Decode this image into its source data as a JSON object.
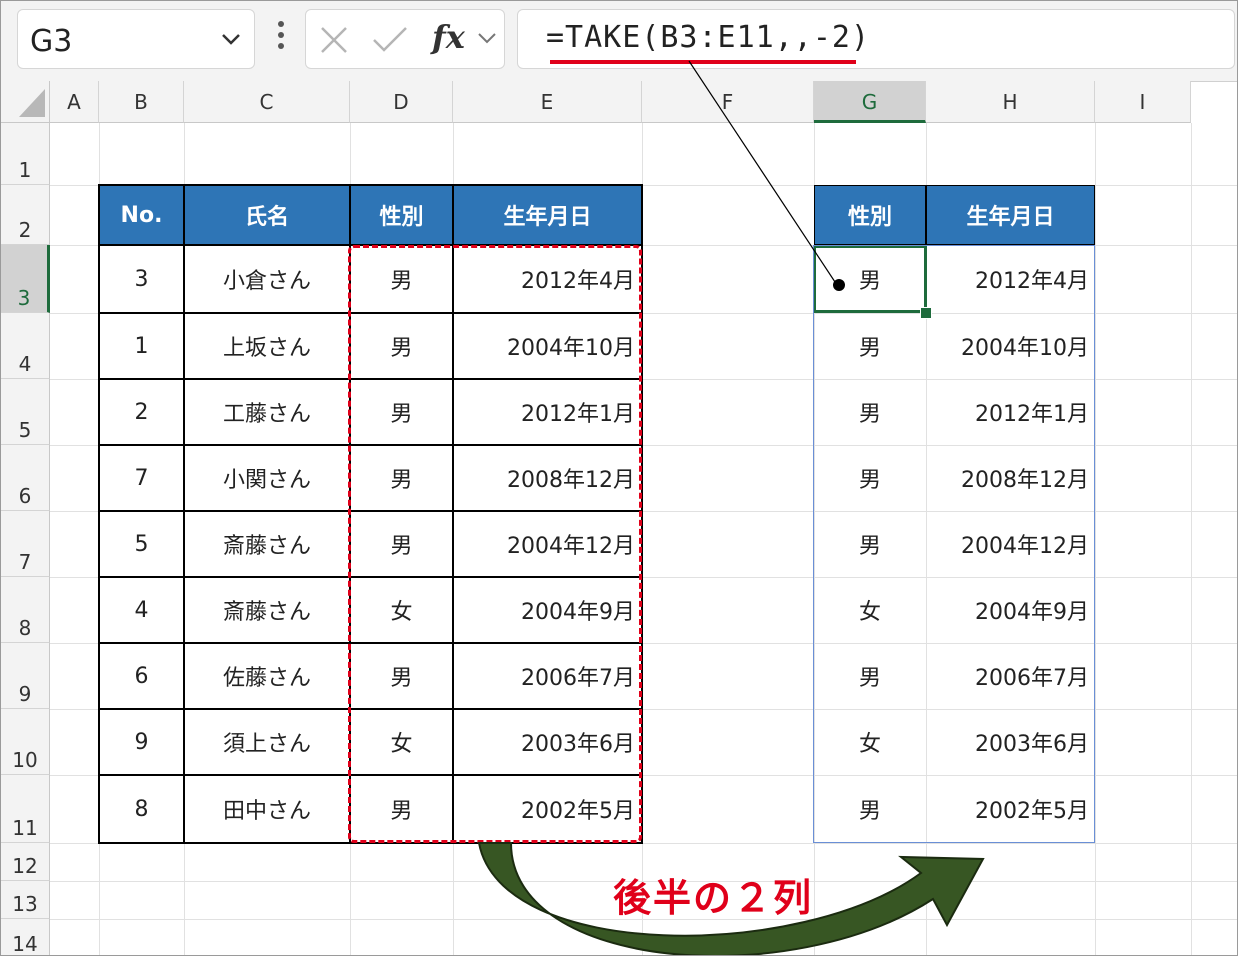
{
  "name_box": {
    "value": "G3"
  },
  "formula_bar": {
    "formula": "=TAKE(B3:E11,,-2)",
    "fx_label": "fx"
  },
  "columns": [
    "A",
    "B",
    "C",
    "D",
    "E",
    "F",
    "G",
    "H",
    "I"
  ],
  "rows": [
    "1",
    "2",
    "3",
    "4",
    "5",
    "6",
    "7",
    "8",
    "9",
    "10",
    "11",
    "12",
    "13",
    "14"
  ],
  "source_table": {
    "headers": [
      "No.",
      "氏名",
      "性別",
      "生年月日"
    ],
    "rows": [
      [
        "3",
        "小倉さん",
        "男",
        "2012年4月"
      ],
      [
        "1",
        "上坂さん",
        "男",
        "2004年10月"
      ],
      [
        "2",
        "工藤さん",
        "男",
        "2012年1月"
      ],
      [
        "7",
        "小関さん",
        "男",
        "2008年12月"
      ],
      [
        "5",
        "斎藤さん",
        "男",
        "2004年12月"
      ],
      [
        "4",
        "斎藤さん",
        "女",
        "2004年9月"
      ],
      [
        "6",
        "佐藤さん",
        "男",
        "2006年7月"
      ],
      [
        "9",
        "須上さん",
        "女",
        "2003年6月"
      ],
      [
        "8",
        "田中さん",
        "男",
        "2002年5月"
      ]
    ]
  },
  "result_table": {
    "headers": [
      "性別",
      "生年月日"
    ],
    "rows": [
      [
        "男",
        "2012年4月"
      ],
      [
        "男",
        "2004年10月"
      ],
      [
        "男",
        "2012年1月"
      ],
      [
        "男",
        "2008年12月"
      ],
      [
        "男",
        "2004年12月"
      ],
      [
        "女",
        "2004年9月"
      ],
      [
        "男",
        "2006年7月"
      ],
      [
        "女",
        "2003年6月"
      ],
      [
        "男",
        "2002年5月"
      ]
    ]
  },
  "annotation": {
    "text": "後半の２列"
  },
  "colors": {
    "header_fill": "#2e75b6",
    "accent_red": "#e0001a",
    "arrow_green": "#2e4a1e",
    "selection_green": "#1e6b3c"
  }
}
